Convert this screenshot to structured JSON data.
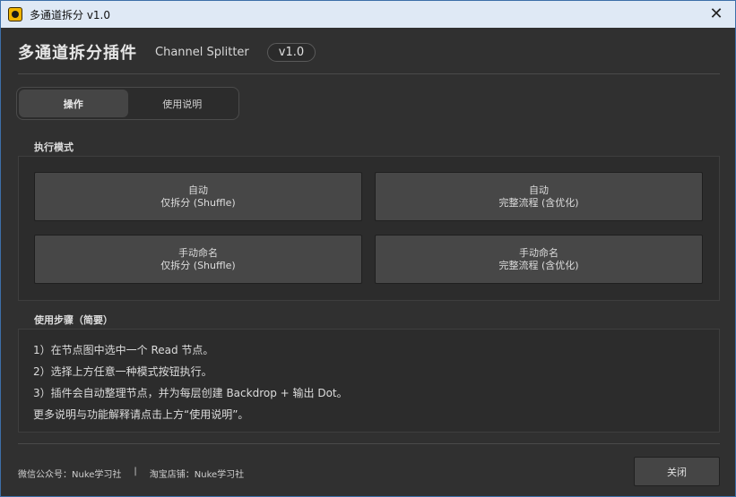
{
  "window": {
    "title": "多通道拆分  v1.0",
    "close_glyph": "✕"
  },
  "header": {
    "title": "多通道拆分插件",
    "subtitle": "Channel Splitter",
    "version": "v1.0"
  },
  "tabs": [
    {
      "label": "操作",
      "active": true
    },
    {
      "label": "使用说明",
      "active": false
    }
  ],
  "execution": {
    "label": "执行模式",
    "buttons": [
      {
        "line1": "自动",
        "line2": "仅拆分 (Shuffle)"
      },
      {
        "line1": "自动",
        "line2": "完整流程 (含优化)"
      },
      {
        "line1": "手动命名",
        "line2": "仅拆分 (Shuffle)"
      },
      {
        "line1": "手动命名",
        "line2": "完整流程 (含优化)"
      }
    ]
  },
  "steps": {
    "label": "使用步骤（简要）",
    "lines": [
      "1）在节点图中选中一个 Read 节点。",
      "2）选择上方任意一种模式按钮执行。",
      "3）插件会自动整理节点，并为每层创建 Backdrop + 输出 Dot。",
      "更多说明与功能解释请点击上方“使用说明”。"
    ]
  },
  "footer": {
    "wechat": "微信公众号：Nuke学习社",
    "separator": "|",
    "shop": "淘宝店铺：Nuke学习社",
    "close_label": "关闭"
  },
  "colors": {
    "titlebar_bg": "#dfe9f5",
    "window_bg": "#303030",
    "button_bg": "#474747",
    "icon_accent": "#f0b500"
  }
}
